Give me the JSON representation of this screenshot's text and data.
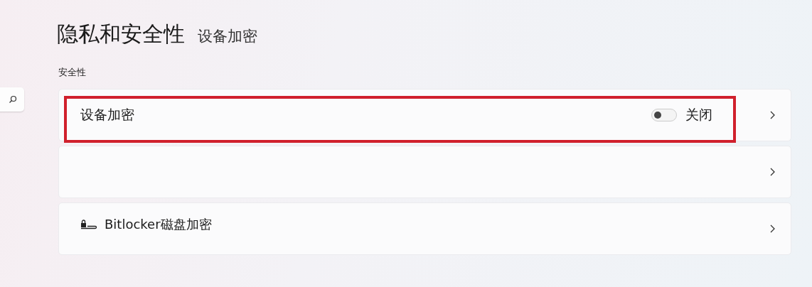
{
  "header": {
    "title": "隐私和安全性",
    "breadcrumb": "设备加密"
  },
  "section": {
    "label": "安全性"
  },
  "rows": [
    {
      "kind": "toggle",
      "label": "设备加密",
      "on": false,
      "state_text": "关闭",
      "highlighted": true
    },
    {
      "kind": "empty",
      "highlighted": false
    },
    {
      "kind": "drive",
      "label": "Bitlocker磁盘加密",
      "highlighted": false
    }
  ]
}
